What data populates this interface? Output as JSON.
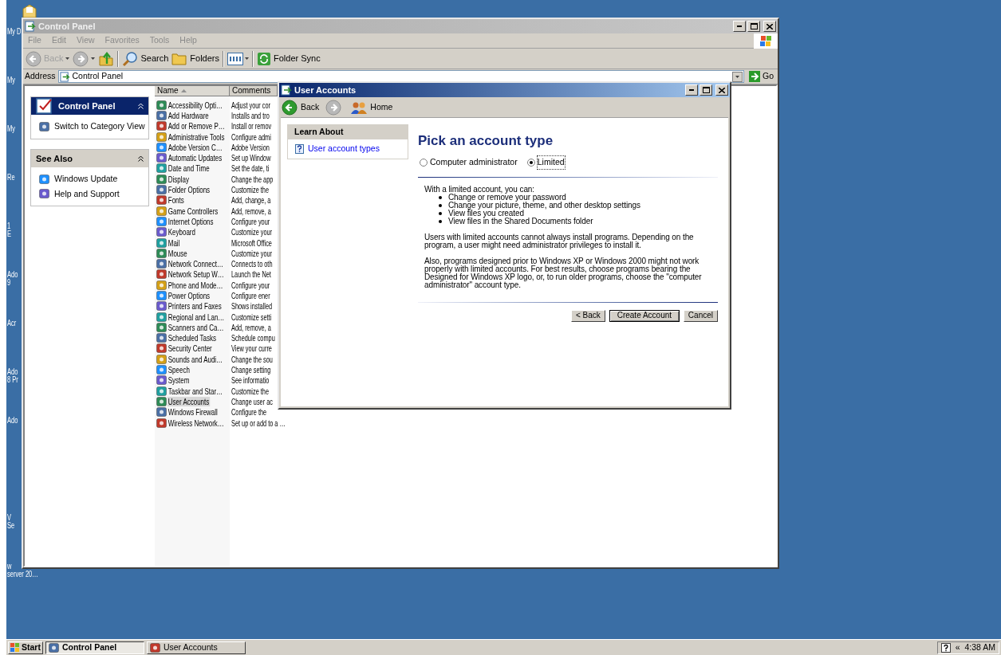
{
  "desktop_icons": [
    {
      "lines": [
        "My D"
      ]
    },
    {
      "lines": [
        "My"
      ]
    },
    {
      "lines": [
        "My"
      ]
    },
    {
      "lines": [
        "Re"
      ]
    },
    {
      "lines": [
        "1",
        "E"
      ]
    },
    {
      "lines": [
        "Ado",
        "9"
      ]
    },
    {
      "lines": [
        "Acr"
      ]
    },
    {
      "lines": [
        "Ado",
        "8 Pr"
      ]
    },
    {
      "lines": [
        "Ado"
      ]
    },
    {
      "lines": [
        "V",
        "Se"
      ]
    },
    {
      "lines": [
        "w",
        "server 20…"
      ]
    }
  ],
  "explorer": {
    "title": "Control Panel",
    "active": false,
    "menu": [
      "File",
      "Edit",
      "View",
      "Favorites",
      "Tools",
      "Help"
    ],
    "toolbar": [
      {
        "kind": "back",
        "label": "Back",
        "disabled": true
      },
      {
        "kind": "forward",
        "disabled": true
      },
      {
        "kind": "up"
      },
      {
        "kind": "separator"
      },
      {
        "kind": "search",
        "label": "Search"
      },
      {
        "kind": "folders",
        "label": "Folders"
      },
      {
        "kind": "separator"
      },
      {
        "kind": "views"
      },
      {
        "kind": "separator"
      },
      {
        "kind": "sync",
        "label": "Folder Sync"
      }
    ],
    "address": {
      "label": "Address",
      "value": "Control Panel",
      "go": "Go"
    },
    "task_panes": [
      {
        "kind": "primary",
        "title": "Control Panel",
        "items": [
          "Switch to Category View"
        ]
      },
      {
        "kind": "secondary",
        "title": "See Also",
        "items": [
          "Windows Update",
          "Help and Support"
        ]
      }
    ],
    "list": {
      "columns": [
        {
          "label": "Name",
          "sorted": true
        },
        {
          "label": "Comments",
          "sorted": false
        }
      ],
      "rows": [
        {
          "name": "Accessibility Opti…",
          "comment": "Adjust your cor",
          "selected": false
        },
        {
          "name": "Add Hardware",
          "comment": "Installs and tro",
          "selected": false
        },
        {
          "name": "Add or Remove P…",
          "comment": "Install or remov",
          "selected": false
        },
        {
          "name": "Administrative Tools",
          "comment": "Configure admi",
          "selected": false
        },
        {
          "name": "Adobe Version C…",
          "comment": "Adobe Version",
          "selected": false
        },
        {
          "name": "Automatic Updates",
          "comment": "Set up Window",
          "selected": false
        },
        {
          "name": "Date and Time",
          "comment": "Set the date, ti",
          "selected": false
        },
        {
          "name": "Display",
          "comment": "Change the app",
          "selected": false
        },
        {
          "name": "Folder Options",
          "comment": "Customize the",
          "selected": false
        },
        {
          "name": "Fonts",
          "comment": "Add, change, a",
          "selected": false
        },
        {
          "name": "Game Controllers",
          "comment": "Add, remove, a",
          "selected": false
        },
        {
          "name": "Internet Options",
          "comment": "Configure your",
          "selected": false
        },
        {
          "name": "Keyboard",
          "comment": "Customize your",
          "selected": false
        },
        {
          "name": "Mail",
          "comment": "Microsoft Office",
          "selected": false
        },
        {
          "name": "Mouse",
          "comment": "Customize your",
          "selected": false
        },
        {
          "name": "Network Connect…",
          "comment": "Connects to oth",
          "selected": false
        },
        {
          "name": "Network Setup W…",
          "comment": "Launch the Net",
          "selected": false
        },
        {
          "name": "Phone and Mode…",
          "comment": "Configure your",
          "selected": false
        },
        {
          "name": "Power Options",
          "comment": "Configure ener",
          "selected": false
        },
        {
          "name": "Printers and Faxes",
          "comment": "Shows installed",
          "selected": false
        },
        {
          "name": "Regional and Lan…",
          "comment": "Customize setti",
          "selected": false
        },
        {
          "name": "Scanners and Ca…",
          "comment": "Add, remove, a",
          "selected": false
        },
        {
          "name": "Scheduled Tasks",
          "comment": "Schedule compu",
          "selected": false
        },
        {
          "name": "Security Center",
          "comment": "View your curre",
          "selected": false
        },
        {
          "name": "Sounds and Audi…",
          "comment": "Change the sou",
          "selected": false
        },
        {
          "name": "Speech",
          "comment": "Change setting",
          "selected": false
        },
        {
          "name": "System",
          "comment": "See informatio",
          "selected": false
        },
        {
          "name": "Taskbar and Star…",
          "comment": "Customize the",
          "selected": false
        },
        {
          "name": "User Accounts",
          "comment": "Change user ac",
          "selected": true
        },
        {
          "name": "Windows Firewall",
          "comment": "Configure the",
          "selected": false
        },
        {
          "name": "Wireless Network…",
          "comment": "Set up or add to a …",
          "selected": false
        }
      ]
    }
  },
  "dialog": {
    "title": "User Accounts",
    "active": true,
    "nav": [
      {
        "kind": "back",
        "label": "Back",
        "disabled": false
      },
      {
        "kind": "forward",
        "disabled": true
      },
      {
        "kind": "home",
        "label": "Home",
        "disabled": false
      }
    ],
    "learn_about": {
      "title": "Learn About",
      "items": [
        "User account types"
      ]
    },
    "heading": "Pick an account type",
    "radios": [
      {
        "label": "Computer administrator",
        "selected": false
      },
      {
        "label": "Limited",
        "selected": true
      }
    ],
    "intro": "With a limited account, you can:",
    "bullets": [
      "Change or remove your password",
      "Change your picture, theme, and other desktop settings",
      "View files you created",
      "View files in the Shared Documents folder"
    ],
    "paragraphs": [
      "Users with limited accounts cannot always install programs. Depending on the program, a user might need administrator privileges to install it.",
      "Also, programs designed prior to Windows XP or Windows 2000 might not work properly with limited accounts. For best results, choose programs bearing the Designed for Windows XP logo, or, to run older programs, choose the \"computer administrator\" account type."
    ],
    "buttons": [
      {
        "label": "< Back",
        "default": false
      },
      {
        "label": "Create Account",
        "default": true
      },
      {
        "label": "Cancel",
        "default": false
      }
    ]
  },
  "taskbar": {
    "start": "Start",
    "tasks": [
      {
        "label": "Control Panel",
        "selected": true
      },
      {
        "label": "User Accounts",
        "selected": false
      }
    ],
    "tray": {
      "chevron": "«",
      "clock": "4:38 AM"
    }
  }
}
